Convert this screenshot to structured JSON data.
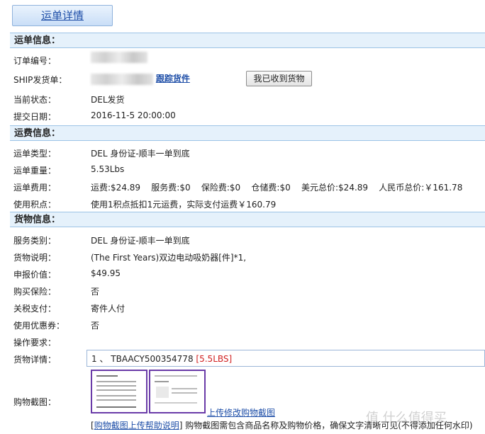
{
  "page_title": "运单详情",
  "sections": {
    "shipment": "运单信息：",
    "shipping_fee": "运费信息：",
    "goods": "货物信息："
  },
  "shipment": {
    "order_no_label": "订单编号：",
    "ship_no_label": "SHIP发货单：",
    "track_link": "跟踪货件",
    "received_button": "我已收到货物",
    "status_label": "当前状态：",
    "status_value": "DEL发货",
    "submit_date_label": "提交日期：",
    "submit_date_value": "2016-11-5 20:00:00"
  },
  "fee": {
    "type_label": "运单类型：",
    "type_value": "DEL 身份证-顺丰一单到底",
    "weight_label": "运单重量：",
    "weight_value": "5.53Lbs",
    "cost_label": "运单费用：",
    "cost_value": "运费:$24.89    服务费:$0    保险费:$0    仓储费:$0    美元总价:$24.89    人民币总价:￥161.78",
    "points_label": "使用积点：",
    "points_value": "使用1积点抵扣1元运费，实际支付运费￥160.79"
  },
  "goods": {
    "service_label": "服务类别：",
    "service_value": "DEL 身份证-顺丰一单到底",
    "desc_label": "货物说明：",
    "desc_value": "(The First Years)双边电动吸奶器[件]*1,",
    "declared_label": "申报价值：",
    "declared_value": "$49.95",
    "insurance_label": "购买保险：",
    "insurance_value": "否",
    "tax_label": "关税支付：",
    "tax_value": "寄件人付",
    "coupon_label": "使用优惠券：",
    "coupon_value": "否",
    "ops_label": "操作要求：",
    "detail_label": "货物详情：",
    "detail_item": "1 、 TBAACY500354778",
    "detail_weight": "[5.5LBS]",
    "screenshot_label": "购物截图：",
    "upload_link": "上传修改购物截图",
    "help_link": "购物截图上传帮助说明",
    "help_text": "购物截图需包含商品名称及购物价格，确保文字清晰可见(不得添加任何水印)"
  },
  "watermark": "值 什么值得买"
}
